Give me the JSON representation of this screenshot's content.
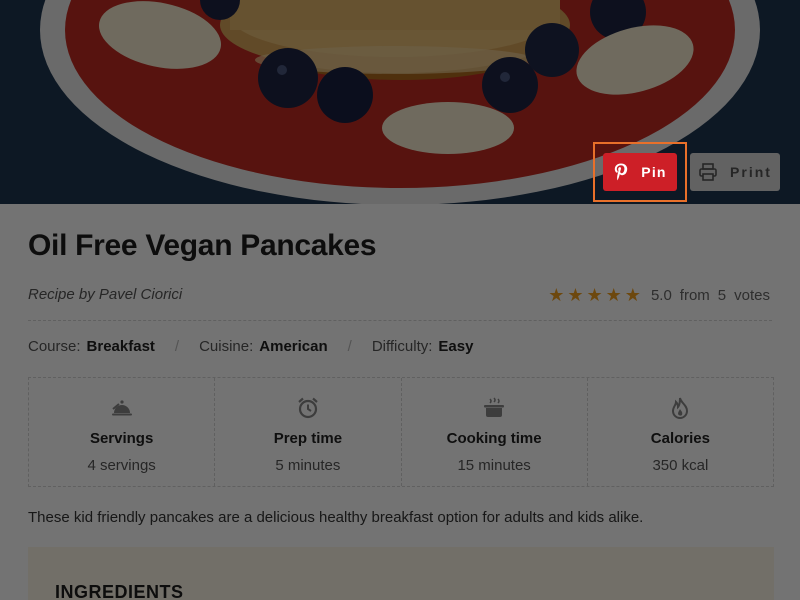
{
  "colors": {
    "pin": "#cd1f27",
    "focus_ring": "#e8702a",
    "star": "#f1a01f",
    "ingredients_bg": "#fdf6e6"
  },
  "hero": {
    "image": "pancakes-with-blueberries-and-banana-photo"
  },
  "actions": {
    "pin": {
      "label": "Pin",
      "icon": "pinterest-icon"
    },
    "print": {
      "label": "Print",
      "icon": "printer-icon"
    }
  },
  "recipe": {
    "title": "Oil Free Vegan Pancakes",
    "author": "Recipe by Pavel Ciorici",
    "rating": {
      "stars": 5,
      "score": "5.0",
      "from_label": "from",
      "votes": "5",
      "votes_label": "votes"
    },
    "meta": [
      {
        "label": "Course:",
        "value": "Breakfast"
      },
      {
        "label": "Cuisine:",
        "value": "American"
      },
      {
        "label": "Difficulty:",
        "value": "Easy"
      }
    ],
    "stats": [
      {
        "icon": "serving-cloche-icon",
        "label": "Servings",
        "value": "4 servings"
      },
      {
        "icon": "alarm-clock-icon",
        "label": "Prep time",
        "value": "5 minutes"
      },
      {
        "icon": "cooking-pot-icon",
        "label": "Cooking time",
        "value": "15 minutes"
      },
      {
        "icon": "flame-icon",
        "label": "Calories",
        "value": "350 kcal"
      }
    ],
    "description": "These kid friendly pancakes are a delicious healthy breakfast option for adults and kids alike.",
    "ingredients_heading": "INGREDIENTS"
  }
}
